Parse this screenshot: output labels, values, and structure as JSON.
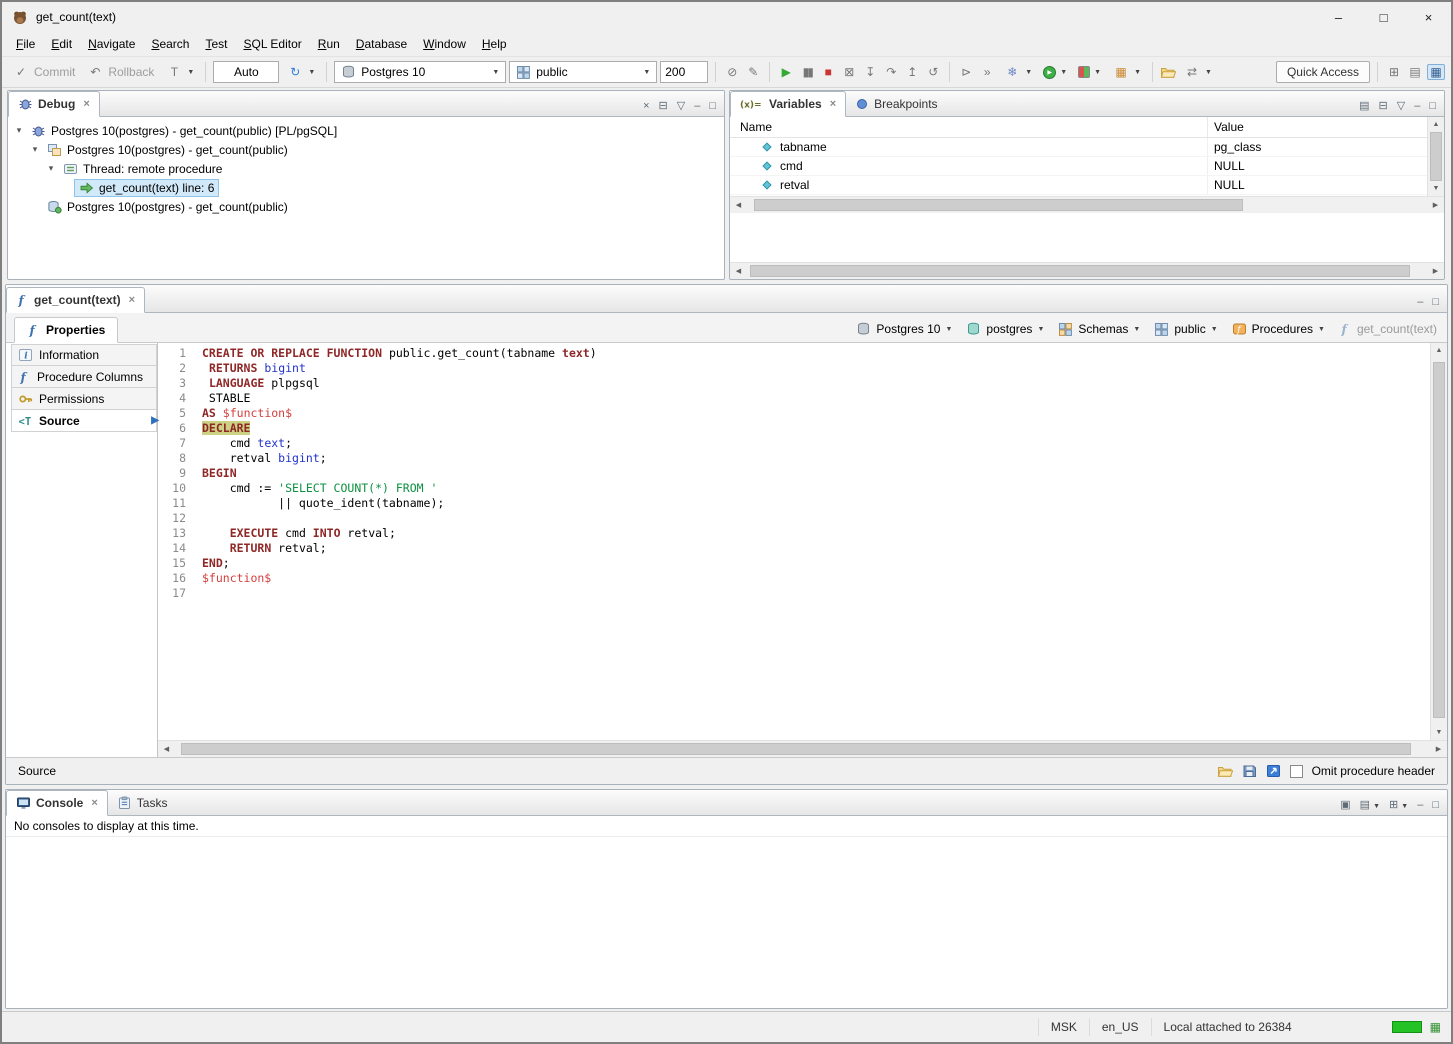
{
  "window": {
    "title": "get_count(text)",
    "controls": {
      "minimize": "–",
      "maximize": "□",
      "close": "×"
    }
  },
  "menu": {
    "items": [
      "File",
      "Edit",
      "Navigate",
      "Search",
      "Test",
      "SQL Editor",
      "Run",
      "Database",
      "Window",
      "Help"
    ]
  },
  "toolbar": {
    "commit": "Commit",
    "rollback": "Rollback",
    "txn_mode": "Auto",
    "database": "Postgres 10",
    "schema": "public",
    "fetch_size": "200",
    "quick_access": "Quick Access"
  },
  "debug_panel": {
    "tab": "Debug",
    "tree": [
      {
        "depth": 0,
        "expanded": true,
        "icon": "debug-target-icon",
        "label": "Postgres 10(postgres) - get_count(public) [PL/pgSQL]",
        "selected": false
      },
      {
        "depth": 1,
        "expanded": true,
        "icon": "process-icon",
        "label": "Postgres 10(postgres) - get_count(public)",
        "selected": false
      },
      {
        "depth": 2,
        "expanded": true,
        "icon": "thread-icon",
        "label": "Thread: remote procedure",
        "selected": false
      },
      {
        "depth": 3,
        "expanded": null,
        "icon": "stack-frame-icon",
        "label": "get_count(text) line: 6",
        "selected": true
      },
      {
        "depth": 1,
        "expanded": null,
        "icon": "session-icon",
        "label": "Postgres 10(postgres) - get_count(public)",
        "selected": false
      }
    ]
  },
  "variables_panel": {
    "tabs": [
      {
        "label": "Variables"
      },
      {
        "label": "Breakpoints"
      }
    ],
    "columns": [
      "Name",
      "Value"
    ],
    "rows": [
      {
        "name": "tabname",
        "value": "pg_class"
      },
      {
        "name": "cmd",
        "value": "NULL"
      },
      {
        "name": "retval",
        "value": "NULL"
      }
    ]
  },
  "editor": {
    "tab_label": "get_count(text)",
    "properties_tab_label": "Properties",
    "breadcrumb": [
      {
        "label": "Postgres 10",
        "icon": "database-icon",
        "disabled": false
      },
      {
        "label": "postgres",
        "icon": "database-node-icon",
        "disabled": false
      },
      {
        "label": "Schemas",
        "icon": "schemas-folder-icon",
        "disabled": false
      },
      {
        "label": "public",
        "icon": "schema-icon",
        "disabled": false
      },
      {
        "label": "Procedures",
        "icon": "procedures-folder-icon",
        "disabled": false
      },
      {
        "label": "get_count(text)",
        "icon": "function-icon",
        "disabled": true
      }
    ],
    "sidebar": [
      {
        "label": "Information",
        "icon": "information-icon",
        "selected": false
      },
      {
        "label": "Procedure Columns",
        "icon": "function-icon",
        "selected": false
      },
      {
        "label": "Permissions",
        "icon": "permissions-icon",
        "selected": false
      },
      {
        "label": "Source",
        "icon": "source-icon",
        "selected": true
      }
    ],
    "current_line": 6,
    "lines": [
      {
        "num": 1,
        "tokens": [
          {
            "t": "CREATE OR REPLACE FUNCTION",
            "c": "kw"
          },
          {
            "t": " public.get_count(tabname ",
            "c": "pl"
          },
          {
            "t": "text",
            "c": "kw"
          },
          {
            "t": ")",
            "c": "pl"
          }
        ]
      },
      {
        "num": 2,
        "tokens": [
          {
            "t": " ",
            "c": "pl"
          },
          {
            "t": "RETURNS",
            "c": "kw"
          },
          {
            "t": " ",
            "c": "pl"
          },
          {
            "t": "bigint",
            "c": "ty"
          }
        ]
      },
      {
        "num": 3,
        "tokens": [
          {
            "t": " ",
            "c": "pl"
          },
          {
            "t": "LANGUAGE",
            "c": "kw"
          },
          {
            "t": " plpgsql",
            "c": "pl"
          }
        ]
      },
      {
        "num": 4,
        "tokens": [
          {
            "t": " STABLE",
            "c": "pl"
          }
        ]
      },
      {
        "num": 5,
        "tokens": [
          {
            "t": "AS",
            "c": "kw"
          },
          {
            "t": " ",
            "c": "pl"
          },
          {
            "t": "$function$",
            "c": "dq"
          }
        ]
      },
      {
        "num": 6,
        "tokens": [
          {
            "t": "DECLARE",
            "c": "kw cur"
          }
        ]
      },
      {
        "num": 7,
        "tokens": [
          {
            "t": "    cmd ",
            "c": "pl"
          },
          {
            "t": "text",
            "c": "ty"
          },
          {
            "t": ";",
            "c": "pl"
          }
        ]
      },
      {
        "num": 8,
        "tokens": [
          {
            "t": "    retval ",
            "c": "pl"
          },
          {
            "t": "bigint",
            "c": "ty"
          },
          {
            "t": ";",
            "c": "pl"
          }
        ]
      },
      {
        "num": 9,
        "tokens": [
          {
            "t": "BEGIN",
            "c": "kw"
          }
        ]
      },
      {
        "num": 10,
        "tokens": [
          {
            "t": "    cmd := ",
            "c": "pl"
          },
          {
            "t": "'SELECT COUNT(*) FROM '",
            "c": "str"
          }
        ]
      },
      {
        "num": 11,
        "tokens": [
          {
            "t": "           || quote_ident(tabname);",
            "c": "pl"
          }
        ]
      },
      {
        "num": 12,
        "tokens": []
      },
      {
        "num": 13,
        "tokens": [
          {
            "t": "    ",
            "c": "pl"
          },
          {
            "t": "EXECUTE",
            "c": "kw"
          },
          {
            "t": " cmd ",
            "c": "pl"
          },
          {
            "t": "INTO",
            "c": "kw"
          },
          {
            "t": " retval;",
            "c": "pl"
          }
        ]
      },
      {
        "num": 14,
        "tokens": [
          {
            "t": "    ",
            "c": "pl"
          },
          {
            "t": "RETURN",
            "c": "kw"
          },
          {
            "t": " retval;",
            "c": "pl"
          }
        ]
      },
      {
        "num": 15,
        "tokens": [
          {
            "t": "END",
            "c": "kw"
          },
          {
            "t": ";",
            "c": "pl"
          }
        ]
      },
      {
        "num": 16,
        "tokens": [
          {
            "t": "$function$",
            "c": "dq"
          }
        ]
      },
      {
        "num": 17,
        "tokens": []
      }
    ],
    "source_bar": {
      "label": "Source",
      "omit_label": "Omit procedure header"
    }
  },
  "console_panel": {
    "tabs": [
      {
        "label": "Console"
      },
      {
        "label": "Tasks"
      }
    ],
    "message": "No consoles to display at this time."
  },
  "status_bar": {
    "timezone": "MSK",
    "locale": "en_US",
    "connection": "Local attached to 26384"
  }
}
